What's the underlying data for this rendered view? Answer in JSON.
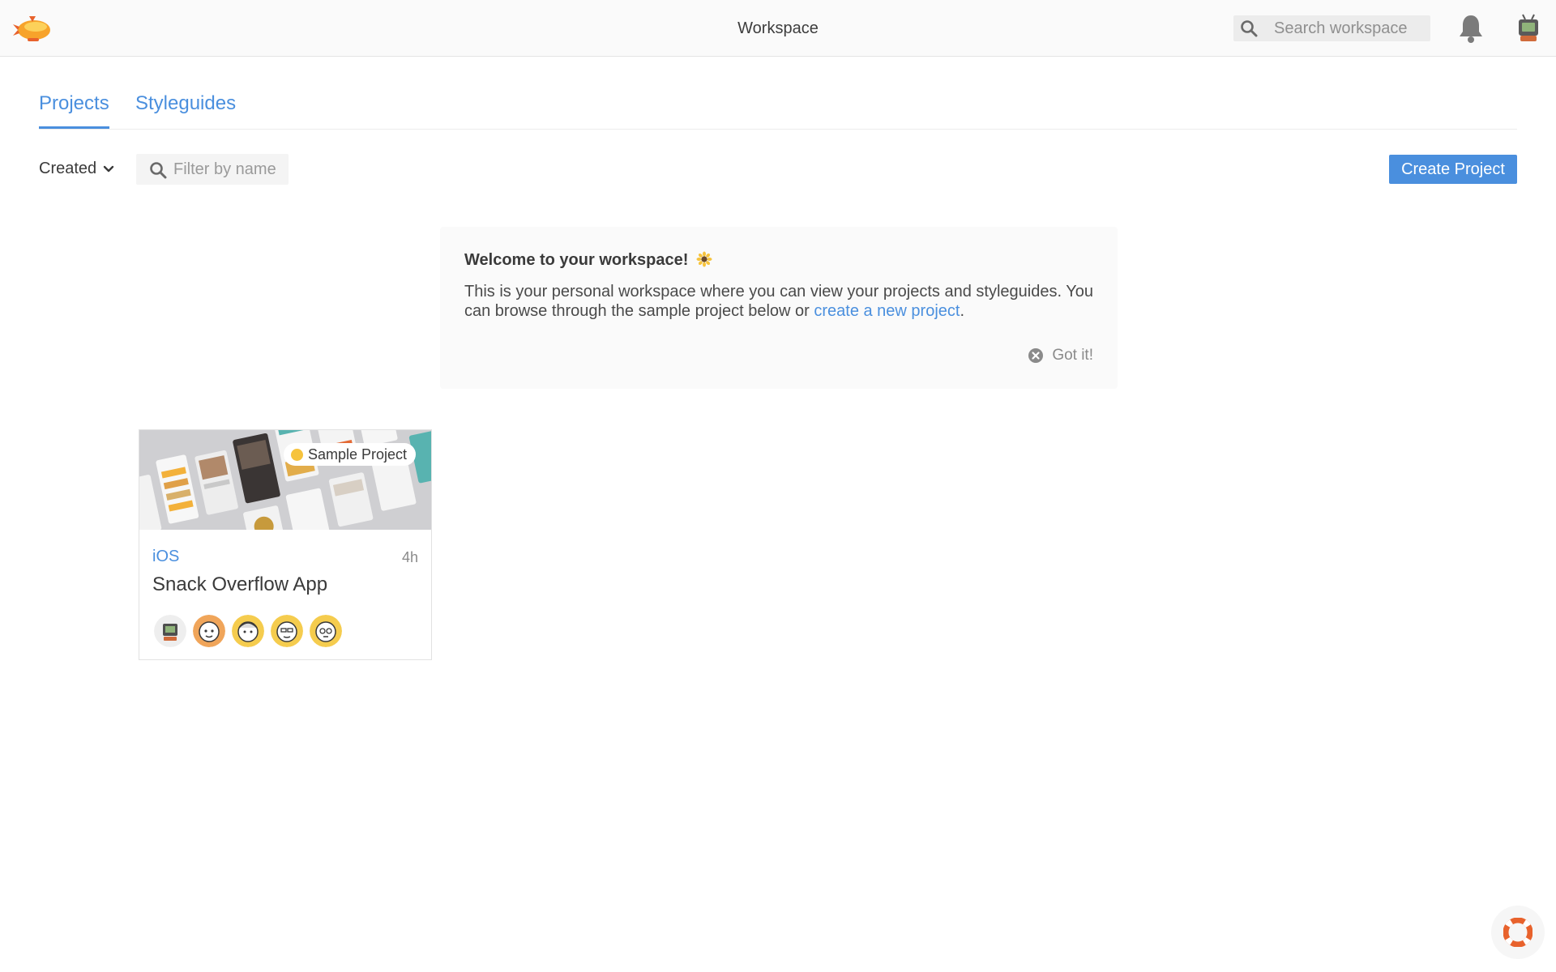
{
  "header": {
    "title": "Workspace",
    "search_placeholder": "Search workspace",
    "icons": {
      "logo": "zeplin-logo",
      "search": "search-icon",
      "notifications": "bell-icon",
      "user": "user-avatar"
    }
  },
  "tabs": [
    {
      "label": "Projects",
      "active": true
    },
    {
      "label": "Styleguides",
      "active": false
    }
  ],
  "toolbar": {
    "sort_label": "Created",
    "filter_placeholder": "Filter by name",
    "create_label": "Create Project"
  },
  "welcome": {
    "title": "Welcome to your workspace!",
    "emoji": "sunflower",
    "body_text": "This is your personal workspace where you can view your projects and styleguides. You can browse through the sample project below or ",
    "link_text": "create a new project",
    "body_end": ".",
    "dismiss_label": "Got it!"
  },
  "projects": [
    {
      "badge": "Sample Project",
      "platform": "iOS",
      "time": "4h",
      "name": "Snack Overflow App",
      "members": [
        "avatar-tv",
        "avatar-orange",
        "avatar-yellow-1",
        "avatar-yellow-2",
        "avatar-yellow-3"
      ]
    }
  ],
  "colors": {
    "accent": "#4a8fde",
    "badge_dot": "#f6c33d",
    "help": "#e8622c"
  },
  "help": {
    "icon": "lifebuoy-icon"
  }
}
